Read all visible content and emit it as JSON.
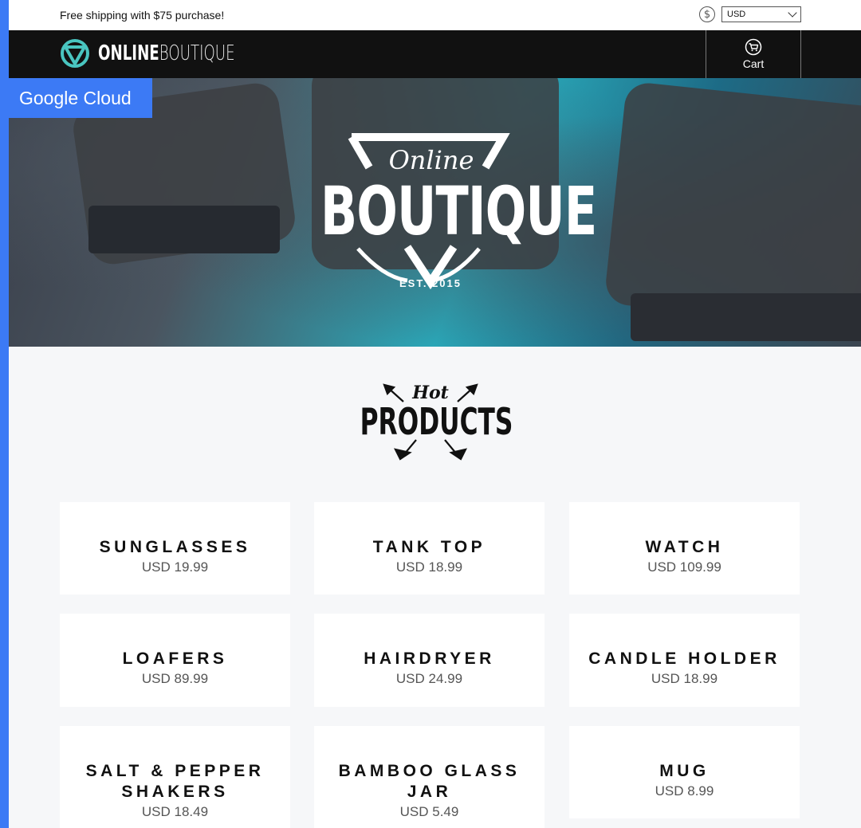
{
  "topbar": {
    "shipping_text": "Free shipping with $75 purchase!",
    "currency_icon": "dollar-circle-icon",
    "currency_value": "USD"
  },
  "navbar": {
    "logo_bold": "ONLINE",
    "logo_light": "BOUTIQUE",
    "cart_label": "Cart",
    "cart_icon": "cart-icon"
  },
  "badge": {
    "label": "Google Cloud",
    "color": "#3c7af5"
  },
  "hero": {
    "script_text": "Online",
    "main_text": "BOUTIQUE",
    "est_text": "EST. 2015"
  },
  "hot_products": {
    "script_text": "Hot",
    "main_text": "PRODUCTS"
  },
  "products": [
    {
      "name": "SUNGLASSES",
      "price": "USD 19.99"
    },
    {
      "name": "TANK TOP",
      "price": "USD 18.99"
    },
    {
      "name": "WATCH",
      "price": "USD 109.99"
    },
    {
      "name": "LOAFERS",
      "price": "USD 89.99"
    },
    {
      "name": "HAIRDRYER",
      "price": "USD 24.99"
    },
    {
      "name": "CANDLE HOLDER",
      "price": "USD 18.99"
    },
    {
      "name": "SALT & PEPPER SHAKERS",
      "price": "USD 18.49"
    },
    {
      "name": "BAMBOO GLASS JAR",
      "price": "USD 5.49"
    },
    {
      "name": "MUG",
      "price": "USD 8.99"
    }
  ]
}
